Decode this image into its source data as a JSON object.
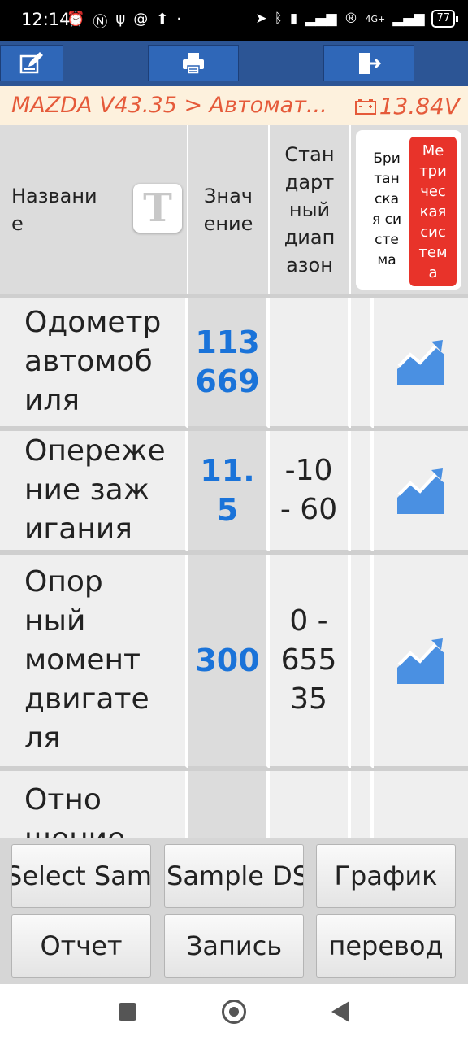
{
  "status_bar": {
    "time": "12:14",
    "battery": "77",
    "network": "4G+"
  },
  "toolbar": {
    "edit_icon": "edit-icon",
    "print_icon": "print-icon",
    "exit_icon": "exit-icon"
  },
  "title_bar": {
    "path": "MAZDA V43.35 > Автомат...",
    "voltage": "13.84V"
  },
  "table": {
    "headers": {
      "name": "Названи\nе",
      "value": "Знач\nение",
      "standard_range": "Стан\nдарт\nный\nдиап\nазон",
      "british_system": "Бри\nтан\nска\nя си\nсте\nма",
      "metric_system": "Ме\nтри\nчес\nкая\nсис\nтем\nа",
      "text_size_button": "T"
    },
    "rows": [
      {
        "name": "Одометр\nавтомоб\nиля",
        "value": "113\n669",
        "range": ""
      },
      {
        "name": "Опереже\nние заж\nигания",
        "value": "11.\n5",
        "range": "-10\n- 60"
      },
      {
        "name": "Опор\nный\nмомент\nдвигате\nля",
        "value": "300",
        "range": "0 -\n655\n35"
      },
      {
        "name": "Отно\nшение",
        "value": "",
        "range": ""
      }
    ]
  },
  "buttons": {
    "select_sample": "Select Sample",
    "sample_ds": "Sample DS",
    "graph": "График",
    "report": "Отчет",
    "record": "Запись",
    "translate": "перевод"
  },
  "colors": {
    "toolbar_bg": "#2c5595",
    "title_text": "#e55a3a",
    "value_text": "#1a73d9",
    "metric_active": "#e8332a"
  }
}
